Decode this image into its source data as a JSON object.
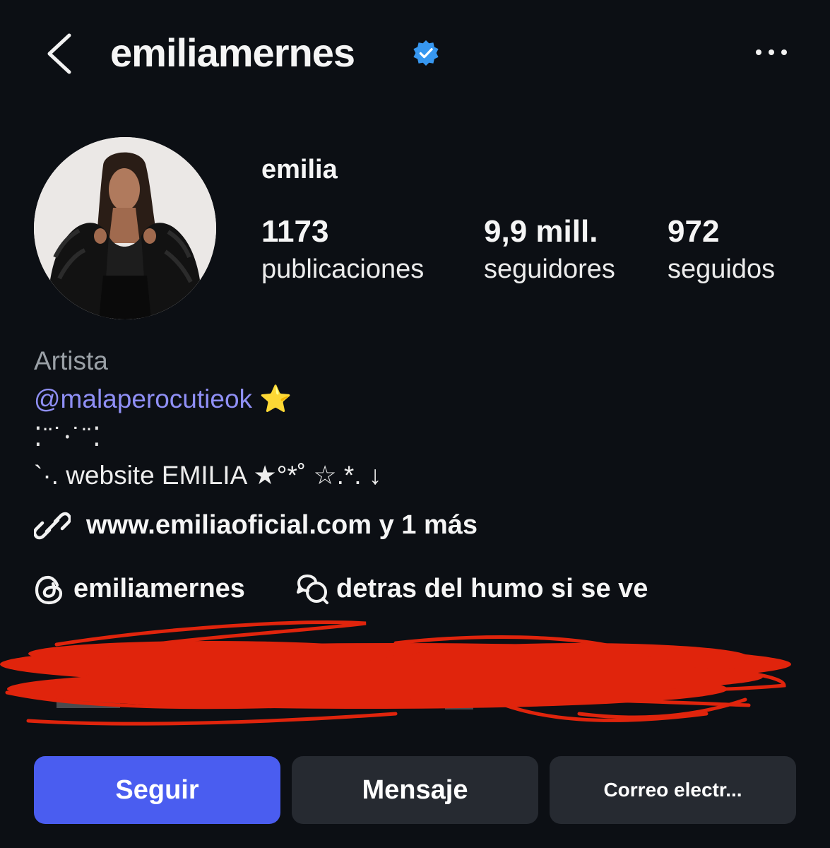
{
  "header": {
    "username": "emiliamernes",
    "verified": true,
    "back_icon": "chevron-left-icon",
    "more_icon": "more-horizontal-icon"
  },
  "profile": {
    "display_name": "emilia",
    "stats": [
      {
        "value": "1173",
        "label": "publicaciones"
      },
      {
        "value": "9,9 mill.",
        "label": "seguidores"
      },
      {
        "value": "972",
        "label": "seguidos"
      }
    ]
  },
  "bio": {
    "category": "Artista",
    "mention": "@malaperocutieok ⭐️",
    "line_decor": "⁚¨˙⸱˙¨⁚",
    "line_website": " `·. website EMILIA ★°*˚ ☆.*. ↓"
  },
  "links": {
    "link_text": "www.emiliaoficial.com y 1 más",
    "threads_handle": "emiliamernes",
    "thread_status": "detras del humo si se ve"
  },
  "actions": {
    "follow": "Seguir",
    "message": "Mensaje",
    "email": "Correo electr..."
  },
  "colors": {
    "background": "#0c0f14",
    "accent_blue": "#4a5df0",
    "verified_blue": "#3797f0",
    "mention_purple": "#8f8ff5",
    "secondary_button": "#262a31",
    "redaction_red": "#e0240c"
  }
}
